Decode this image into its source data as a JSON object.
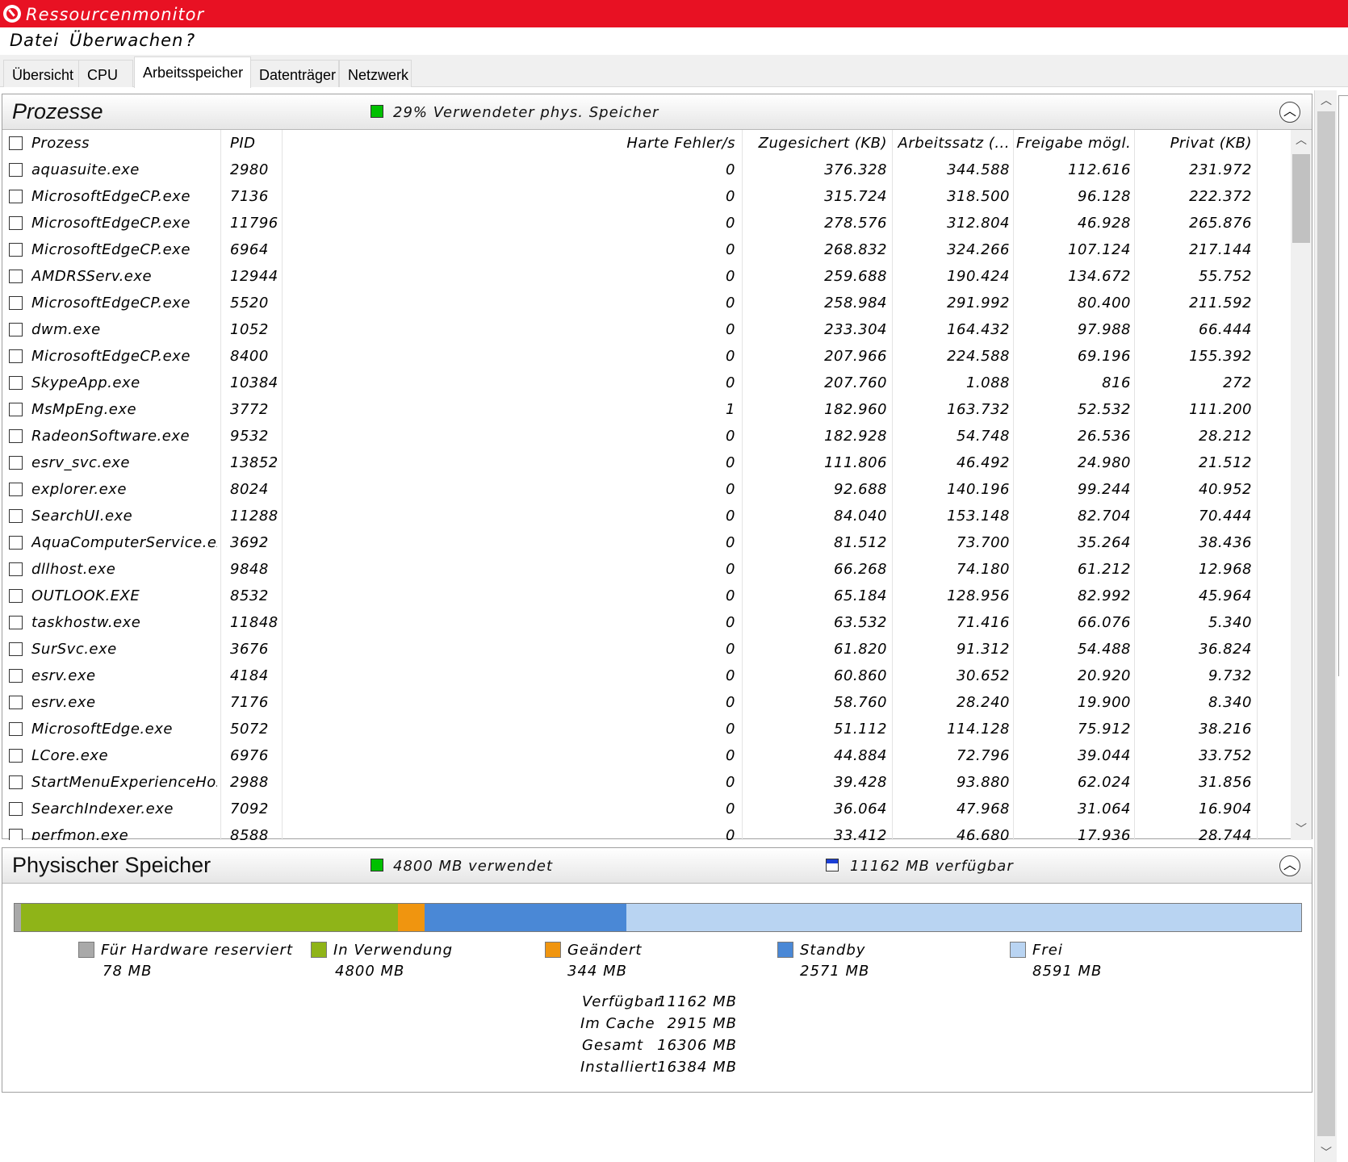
{
  "window": {
    "title": "Ressourcenmonitor"
  },
  "menu": {
    "file": "Datei",
    "monitor": "Überwachen",
    "help": "?"
  },
  "tabs": [
    {
      "label": "Übersicht"
    },
    {
      "label": "CPU"
    },
    {
      "label": "Arbeitsspeicher",
      "active": true
    },
    {
      "label": "Datenträger"
    },
    {
      "label": "Netzwerk"
    }
  ],
  "processes": {
    "title": "Prozesse",
    "status": "29% Verwendeter phys. Speicher",
    "status_color": "#00c000",
    "columns": [
      "Prozess",
      "PID",
      "Harte Fehler/s",
      "Zugesichert (KB)",
      "Arbeitssatz (...",
      "Freigabe mögl...",
      "Privat (KB)"
    ],
    "rows": [
      [
        "aquasuite.exe",
        "2980",
        "0",
        "376.328",
        "344.588",
        "112.616",
        "231.972"
      ],
      [
        "MicrosoftEdgeCP.exe",
        "7136",
        "0",
        "315.724",
        "318.500",
        "96.128",
        "222.372"
      ],
      [
        "MicrosoftEdgeCP.exe",
        "11796",
        "0",
        "278.576",
        "312.804",
        "46.928",
        "265.876"
      ],
      [
        "MicrosoftEdgeCP.exe",
        "6964",
        "0",
        "268.832",
        "324.266",
        "107.124",
        "217.144"
      ],
      [
        "AMDRSServ.exe",
        "12944",
        "0",
        "259.688",
        "190.424",
        "134.672",
        "55.752"
      ],
      [
        "MicrosoftEdgeCP.exe",
        "5520",
        "0",
        "258.984",
        "291.992",
        "80.400",
        "211.592"
      ],
      [
        "dwm.exe",
        "1052",
        "0",
        "233.304",
        "164.432",
        "97.988",
        "66.444"
      ],
      [
        "MicrosoftEdgeCP.exe",
        "8400",
        "0",
        "207.966",
        "224.588",
        "69.196",
        "155.392"
      ],
      [
        "SkypeApp.exe",
        "10384",
        "0",
        "207.760",
        "1.088",
        "816",
        "272"
      ],
      [
        "MsMpEng.exe",
        "3772",
        "1",
        "182.960",
        "163.732",
        "52.532",
        "111.200"
      ],
      [
        "RadeonSoftware.exe",
        "9532",
        "0",
        "182.928",
        "54.748",
        "26.536",
        "28.212"
      ],
      [
        "esrv_svc.exe",
        "13852",
        "0",
        "111.806",
        "46.492",
        "24.980",
        "21.512"
      ],
      [
        "explorer.exe",
        "8024",
        "0",
        "92.688",
        "140.196",
        "99.244",
        "40.952"
      ],
      [
        "SearchUI.exe",
        "11288",
        "0",
        "84.040",
        "153.148",
        "82.704",
        "70.444"
      ],
      [
        "AquaComputerService.exe",
        "3692",
        "0",
        "81.512",
        "73.700",
        "35.264",
        "38.436"
      ],
      [
        "dllhost.exe",
        "9848",
        "0",
        "66.268",
        "74.180",
        "61.212",
        "12.968"
      ],
      [
        "OUTLOOK.EXE",
        "8532",
        "0",
        "65.184",
        "128.956",
        "82.992",
        "45.964"
      ],
      [
        "taskhostw.exe",
        "11848",
        "0",
        "63.532",
        "71.416",
        "66.076",
        "5.340"
      ],
      [
        "SurSvc.exe",
        "3676",
        "0",
        "61.820",
        "91.312",
        "54.488",
        "36.824"
      ],
      [
        "esrv.exe",
        "4184",
        "0",
        "60.860",
        "30.652",
        "20.920",
        "9.732"
      ],
      [
        "esrv.exe",
        "7176",
        "0",
        "58.760",
        "28.240",
        "19.900",
        "8.340"
      ],
      [
        "MicrosoftEdge.exe",
        "5072",
        "0",
        "51.112",
        "114.128",
        "75.912",
        "38.216"
      ],
      [
        "LCore.exe",
        "6976",
        "0",
        "44.884",
        "72.796",
        "39.044",
        "33.752"
      ],
      [
        "StartMenuExperienceHost...",
        "2988",
        "0",
        "39.428",
        "93.880",
        "62.024",
        "31.856"
      ],
      [
        "SearchIndexer.exe",
        "7092",
        "0",
        "36.064",
        "47.968",
        "31.064",
        "16.904"
      ],
      [
        "perfmon.exe",
        "8588",
        "0",
        "33.412",
        "46.680",
        "17.936",
        "28.744"
      ]
    ]
  },
  "physical": {
    "title": "Physischer Speicher",
    "used_text": "4800 MB verwendet",
    "avail_text": "11162 MB verfügbar",
    "used_color": "#00c000",
    "avail_color": "#1c3fd6",
    "bar": [
      {
        "label": "Für Hardware reserviert",
        "value": "78 MB",
        "mb": 78,
        "color": "#a9a9a9"
      },
      {
        "label": "In Verwendung",
        "value": "4800 MB",
        "mb": 4800,
        "color": "#8fb418"
      },
      {
        "label": "Geändert",
        "value": "344 MB",
        "mb": 344,
        "color": "#f0950f"
      },
      {
        "label": "Standby",
        "value": "2571 MB",
        "mb": 2571,
        "color": "#4a88d6"
      },
      {
        "label": "Frei",
        "value": "8591 MB",
        "mb": 8591,
        "color": "#b9d4f2"
      }
    ],
    "summary": [
      {
        "label": "Verfügbar",
        "value": "11162 MB"
      },
      {
        "label": "Im Cache",
        "value": "2915 MB"
      },
      {
        "label": "Gesamt",
        "value": "16306 MB"
      },
      {
        "label": "Installiert",
        "value": "16384 MB"
      }
    ]
  }
}
